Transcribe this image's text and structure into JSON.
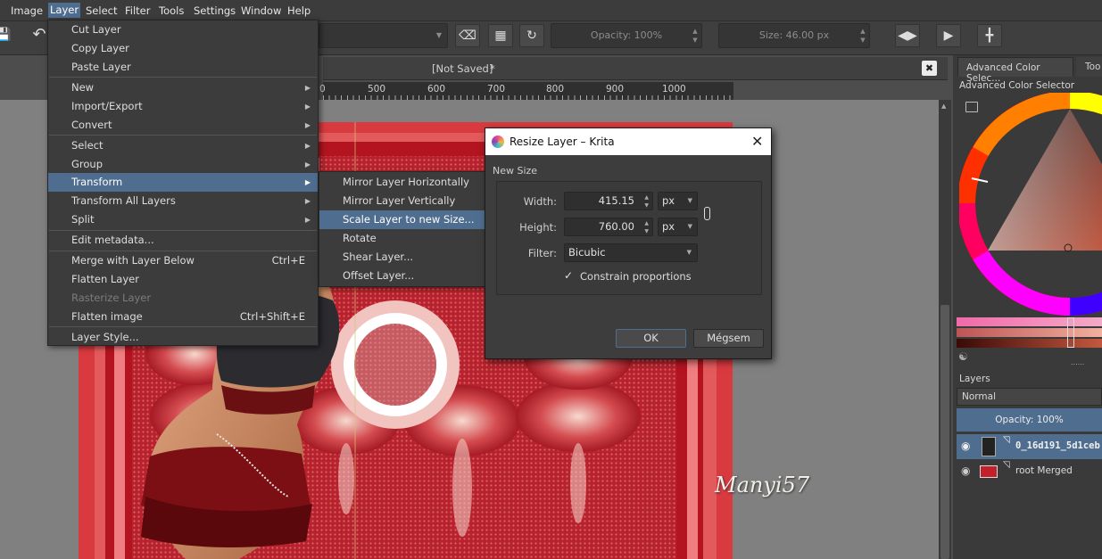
{
  "menubar": {
    "items": [
      "Image",
      "Layer",
      "Select",
      "Filter",
      "Tools",
      "Settings",
      "Window",
      "Help"
    ]
  },
  "toolbar": {
    "opacity_label": "Opacity: 100%",
    "size_label": "Size: 46.00 px"
  },
  "document": {
    "tab_title": "[Not Saved]",
    "modified_marker": "*",
    "ruler_ticks": [
      "0",
      "500",
      "600",
      "700",
      "800",
      "900",
      "1000"
    ]
  },
  "layer_menu": {
    "items": [
      {
        "label": "Cut Layer"
      },
      {
        "label": "Copy Layer"
      },
      {
        "label": "Paste Layer"
      },
      {
        "label": "New",
        "submenu": true
      },
      {
        "label": "Import/Export",
        "submenu": true
      },
      {
        "label": "Convert",
        "submenu": true
      },
      {
        "label": "Select",
        "submenu": true
      },
      {
        "label": "Group",
        "submenu": true
      },
      {
        "label": "Transform",
        "submenu": true,
        "highlighted": true
      },
      {
        "label": "Transform All Layers",
        "submenu": true
      },
      {
        "label": "Split",
        "submenu": true
      },
      {
        "label": "Edit metadata..."
      },
      {
        "label": "Merge with Layer Below",
        "shortcut": "Ctrl+E"
      },
      {
        "label": "Flatten Layer"
      },
      {
        "label": "Rasterize Layer",
        "disabled": true
      },
      {
        "label": "Flatten image",
        "shortcut": "Ctrl+Shift+E"
      },
      {
        "label": "Layer Style..."
      }
    ]
  },
  "transform_submenu": {
    "items": [
      {
        "label": "Mirror Layer Horizontally"
      },
      {
        "label": "Mirror Layer Vertically"
      },
      {
        "label": "Scale Layer to new Size...",
        "highlighted": true
      },
      {
        "label": "Rotate"
      },
      {
        "label": "Shear Layer..."
      },
      {
        "label": "Offset Layer..."
      }
    ]
  },
  "dialog": {
    "title": "Resize Layer – Krita",
    "section": "New Size",
    "width_label": "Width:",
    "width_value": "415.15",
    "width_unit": "px",
    "height_label": "Height:",
    "height_value": "760.00",
    "height_unit": "px",
    "filter_label": "Filter:",
    "filter_value": "Bicubic",
    "constrain_label": "Constrain proportions",
    "constrain_checked": true,
    "ok_label": "OK",
    "cancel_label": "Mégsem"
  },
  "artwork": {
    "watermark": "Manyi57"
  },
  "dock": {
    "tabs": [
      "Advanced Color Selec...",
      "Too"
    ],
    "color_selector_title": "Advanced Color Selector",
    "layers_title": "Layers",
    "blend_mode": "Normal",
    "opacity_label": "Opacity:  100%",
    "layers": [
      {
        "name": "0_16d191_5d1ceb",
        "selected": true
      },
      {
        "name": "root Merged",
        "selected": false
      }
    ]
  },
  "colors": {
    "accent": "#4f6d8f",
    "menu_bg": "#3c3c3c",
    "canvas_bg": "#808080",
    "art_red": "#c4202b"
  }
}
